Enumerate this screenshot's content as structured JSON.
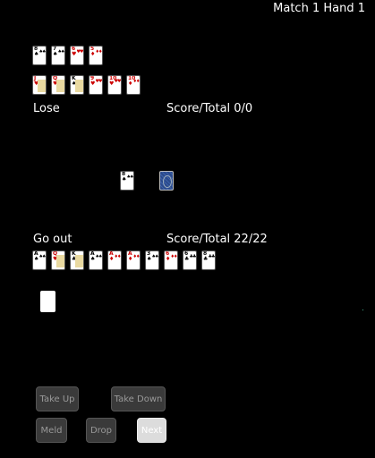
{
  "header": {
    "match_hand": "Match 1 Hand 1"
  },
  "opponent": {
    "status": "Lose",
    "score": "Score/Total 0/0",
    "meld_row": [
      {
        "rank": "8",
        "suit": "♠",
        "color": "black"
      },
      {
        "rank": "7",
        "suit": "♠",
        "color": "black"
      },
      {
        "rank": "6",
        "suit": "♥",
        "color": "red"
      },
      {
        "rank": "5",
        "suit": "♦",
        "color": "red"
      }
    ],
    "meld_row2": [
      {
        "rank": "J",
        "suit": "♥",
        "color": "red",
        "face": true
      },
      {
        "rank": "Q",
        "suit": "♥",
        "color": "red",
        "face": true
      },
      {
        "rank": "K",
        "suit": "♠",
        "color": "black",
        "face": true
      },
      {
        "rank": "9",
        "suit": "♥",
        "color": "red"
      },
      {
        "rank": "10",
        "suit": "♥",
        "color": "red"
      },
      {
        "rank": "10",
        "suit": "♦",
        "color": "red"
      }
    ]
  },
  "table": {
    "discard": {
      "rank": "8",
      "suit": "♠",
      "color": "black"
    },
    "stock": "card-back"
  },
  "player": {
    "status": "Go out",
    "score": "Score/Total 22/22",
    "hand": [
      {
        "rank": "A",
        "suit": "♠",
        "color": "black"
      },
      {
        "rank": "Q",
        "suit": "♥",
        "color": "red",
        "face": true
      },
      {
        "rank": "K",
        "suit": "♣",
        "color": "black",
        "face": true
      },
      {
        "rank": "A",
        "suit": "♠",
        "color": "black"
      },
      {
        "rank": "A",
        "suit": "♦",
        "color": "red"
      },
      {
        "rank": "A",
        "suit": "♦",
        "color": "red"
      },
      {
        "rank": "3",
        "suit": "♠",
        "color": "black"
      },
      {
        "rank": "6",
        "suit": "♦",
        "color": "red"
      },
      {
        "rank": "6",
        "suit": "♣",
        "color": "black"
      },
      {
        "rank": "8",
        "suit": "♣",
        "color": "black"
      }
    ]
  },
  "buttons": {
    "take_up": "Take Up",
    "take_down": "Take Down",
    "meld": "Meld",
    "drop": "Drop",
    "next": "Next"
  }
}
